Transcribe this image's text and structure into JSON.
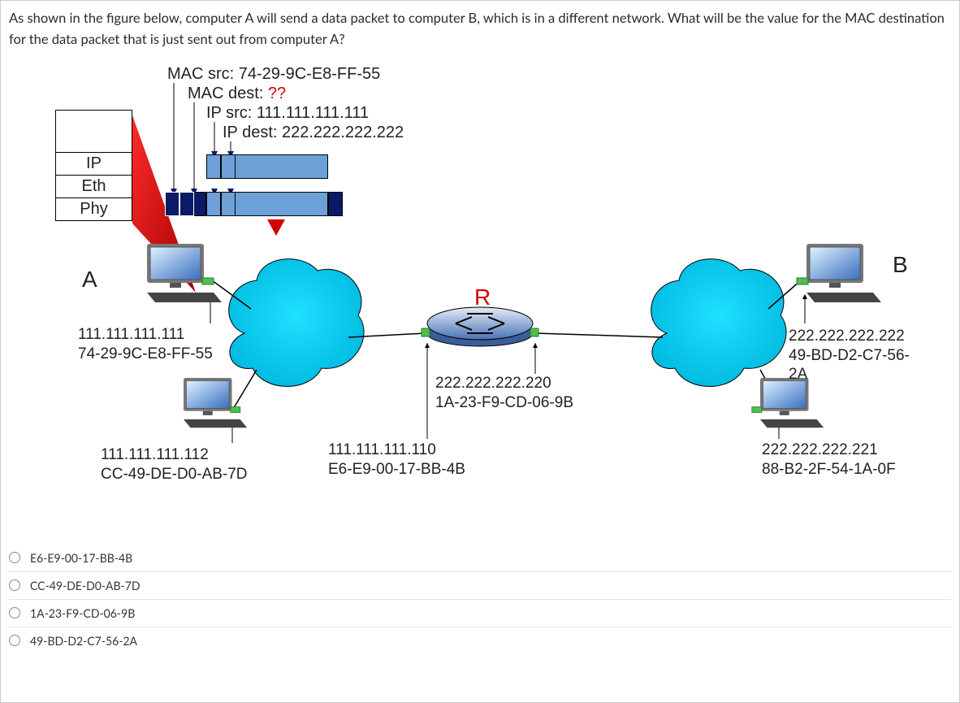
{
  "question": {
    "text": "As shown in the figure below, computer A will send a data packet to computer B, which is in a different network. What will be the value for the MAC destination for the data packet that is just sent out from computer A?"
  },
  "packet_header": {
    "mac_src_label": "MAC src: 74-29-9C-E8-FF-55",
    "mac_dest_label_prefix": "MAC dest: ",
    "mac_dest_unknown": "??",
    "ip_src_label": "IP src: 111.111.111.111",
    "ip_dest_label": "IP dest: 222.222.222.222"
  },
  "layers": {
    "ip": "IP",
    "eth": "Eth",
    "phy": "Phy"
  },
  "labels": {
    "A": "A",
    "B": "B",
    "R": "R"
  },
  "hosts": {
    "A": {
      "ip": "111.111.111.111",
      "mac": "74-29-9C-E8-FF-55"
    },
    "A2": {
      "ip": "111.111.111.112",
      "mac": "CC-49-DE-D0-AB-7D"
    },
    "R_left": {
      "ip": "111.111.111.110",
      "mac": "E6-E9-00-17-BB-4B"
    },
    "R_right": {
      "ip": "222.222.222.220",
      "mac": "1A-23-F9-CD-06-9B"
    },
    "B": {
      "ip": "222.222.222.222",
      "mac": "49-BD-D2-C7-56-2A"
    },
    "B2": {
      "ip": "222.222.222.221",
      "mac": "88-B2-2F-54-1A-0F"
    }
  },
  "answers": [
    {
      "label": "E6-E9-00-17-BB-4B"
    },
    {
      "label": "CC-49-DE-D0-AB-7D"
    },
    {
      "label": "1A-23-F9-CD-06-9B"
    },
    {
      "label": "49-BD-D2-C7-56-2A"
    }
  ]
}
